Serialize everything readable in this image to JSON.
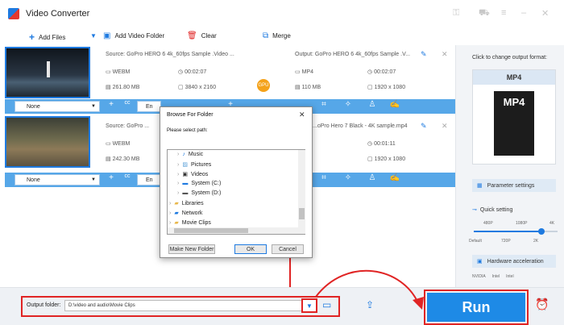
{
  "app": {
    "title": "Video Converter",
    "colors": {
      "accent": "#1e8ae6",
      "highlight": "#e02424",
      "bar": "#56a7e8"
    }
  },
  "toolbar": {
    "add_files": "Add Files",
    "add_video_folder": "Add Video Folder",
    "clear": "Clear",
    "merge": "Merge"
  },
  "files": [
    {
      "source": "Source: GoPro HERO 6 4k_60fps Sample .Video ...",
      "src_format": "WEBM",
      "src_duration": "00:02:07",
      "src_size": "261.80 MB",
      "src_res": "3840 x 2160",
      "output": "Output: GoPro HERO 6 4k_60fps Sample .V...",
      "out_format": "MP4",
      "out_duration": "00:02:07",
      "out_size": "110 MB",
      "out_res": "1920 x 1080",
      "subtitle": "None",
      "audio": "En"
    },
    {
      "source": "Source: GoPro ...",
      "src_format": "WEBM",
      "src_size": "242.30 MB",
      "output": "...oPro Hero 7 Black - 4K sample.mp4",
      "out_duration": "00:01:11",
      "out_res": "1920 x 1080",
      "subtitle": "None",
      "audio": "En"
    }
  ],
  "gpu_label": "GPU",
  "right_panel": {
    "change_format_label": "Click to change output format:",
    "format": "MP4",
    "format_icon_text": "MP4",
    "parameter_settings": "Parameter settings",
    "quick_setting": "Quick setting",
    "quality_top": [
      "480P",
      "1080P",
      "4K"
    ],
    "quality_bottom": [
      "Default",
      "720P",
      "2K"
    ],
    "hardware_acceleration": "Hardware acceleration",
    "hw_vendors": [
      "NVIDIA",
      "Intel",
      "Intel"
    ]
  },
  "bottom": {
    "output_folder_label": "Output folder:",
    "output_folder_value": "D:\\video and audio\\Movie Clips",
    "run": "Run"
  },
  "dialog": {
    "title": "Browse For Folder",
    "prompt": "Please select path:",
    "tree": [
      "Music",
      "Pictures",
      "Videos",
      "System (C:)",
      "System (D:)",
      "Libraries",
      "Network",
      "Movie Clips"
    ],
    "make_new_folder": "Make New Folder",
    "ok": "OK",
    "cancel": "Cancel"
  }
}
